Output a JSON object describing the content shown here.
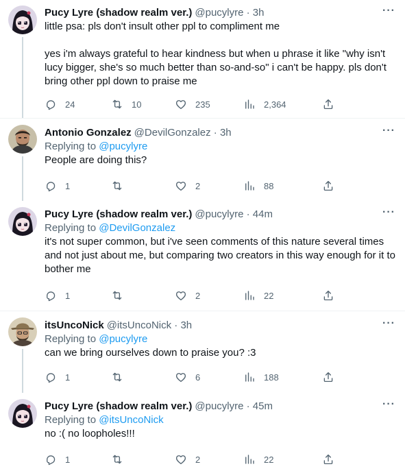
{
  "tweets": [
    {
      "name": "Pucy Lyre (shadow realm ver.)",
      "handle": "@pucylyre · 3h",
      "replying_label": "",
      "replying_user": "",
      "text": "little psa: pls don't insult other ppl to compliment me\n\nyes i'm always grateful to hear kindness but when u phrase it like \"why isn't lucy bigger, she's so much better than so-and-so\" i can't be happy. pls don't bring other ppl down to praise me",
      "replies": "24",
      "retweets": "10",
      "likes": "235",
      "views": "2,364",
      "avatar_icon": "anime-girl-avatar"
    },
    {
      "name": "Antonio Gonzalez",
      "handle": "@DevilGonzalez · 3h",
      "replying_label": "Replying to ",
      "replying_user": "@pucylyre",
      "text": "People are doing this?",
      "replies": "1",
      "retweets": "",
      "likes": "2",
      "views": "88",
      "avatar_icon": "man-photo-avatar"
    },
    {
      "name": "Pucy Lyre (shadow realm ver.)",
      "handle": "@pucylyre · 44m",
      "replying_label": "Replying to ",
      "replying_user": "@DevilGonzalez",
      "text": "it's not super common, but i've seen comments of this nature several times and not just about me, but comparing two creators in this way enough for it to bother me",
      "replies": "1",
      "retweets": "",
      "likes": "2",
      "views": "22",
      "avatar_icon": "anime-girl-avatar"
    },
    {
      "name": "itsUncoNick",
      "handle": "@itsUncoNick · 3h",
      "replying_label": "Replying to ",
      "replying_user": "@pucylyre",
      "text": "can we bring ourselves down to praise you? :3",
      "replies": "1",
      "retweets": "",
      "likes": "6",
      "views": "188",
      "avatar_icon": "man-hat-avatar"
    },
    {
      "name": "Pucy Lyre (shadow realm ver.)",
      "handle": "@pucylyre · 45m",
      "replying_label": "Replying to ",
      "replying_user": "@itsUncoNick",
      "text": "no :( no loopholes!!!",
      "replies": "1",
      "retweets": "",
      "likes": "2",
      "views": "22",
      "avatar_icon": "anime-girl-avatar"
    }
  ],
  "colors": {
    "text": "#0f1419",
    "muted": "#536471",
    "link": "#1d9bf0",
    "line": "#cfd9de",
    "separator": "#eff3f4"
  }
}
